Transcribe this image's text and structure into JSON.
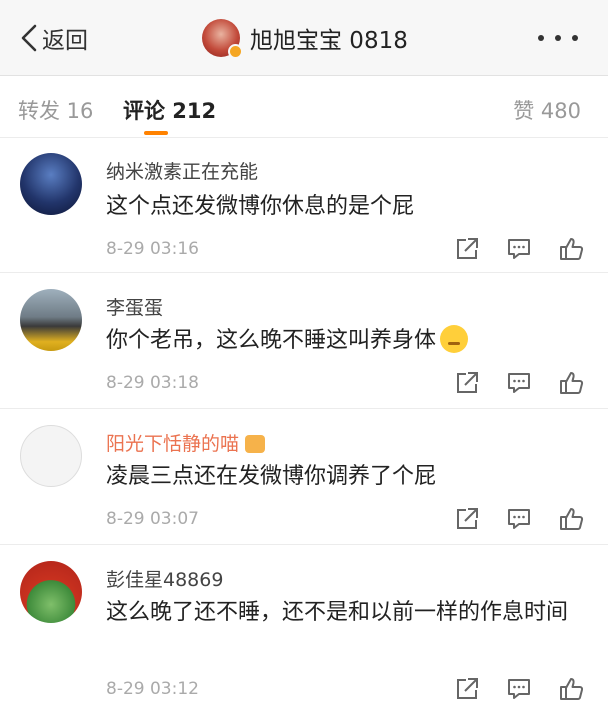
{
  "nav": {
    "back_label": "返回",
    "title": "旭旭宝宝 0818"
  },
  "tabs": {
    "repost": "转发 16",
    "comments": "评论 212",
    "likes": "赞 480"
  },
  "comments": [
    {
      "name": "纳米激素正在充能",
      "text": "这个点还发微博你休息的是个屁",
      "time": "8-29 03:16"
    },
    {
      "name": "李蛋蛋",
      "text": "你个老吊，这么晚不睡这叫养身体",
      "time": "8-29 03:18"
    },
    {
      "name": "阳光下恬静的喵",
      "text": "凌晨三点还在发微博你调养了个屁",
      "time": "8-29 03:07"
    },
    {
      "name": "彭佳星48869",
      "text": "这么晚了还不睡，还不是和以前一样的作息时间",
      "time": "8-29 03:12"
    }
  ],
  "icons": {
    "back": "chevron-left-icon",
    "more": "more-dots-icon",
    "share": "share-icon",
    "reply": "comment-icon",
    "like": "thumbs-up-icon"
  },
  "colors": {
    "accent": "#ff8200",
    "name_highlight": "#eb7350",
    "secondary_text": "#aaaaaa"
  }
}
